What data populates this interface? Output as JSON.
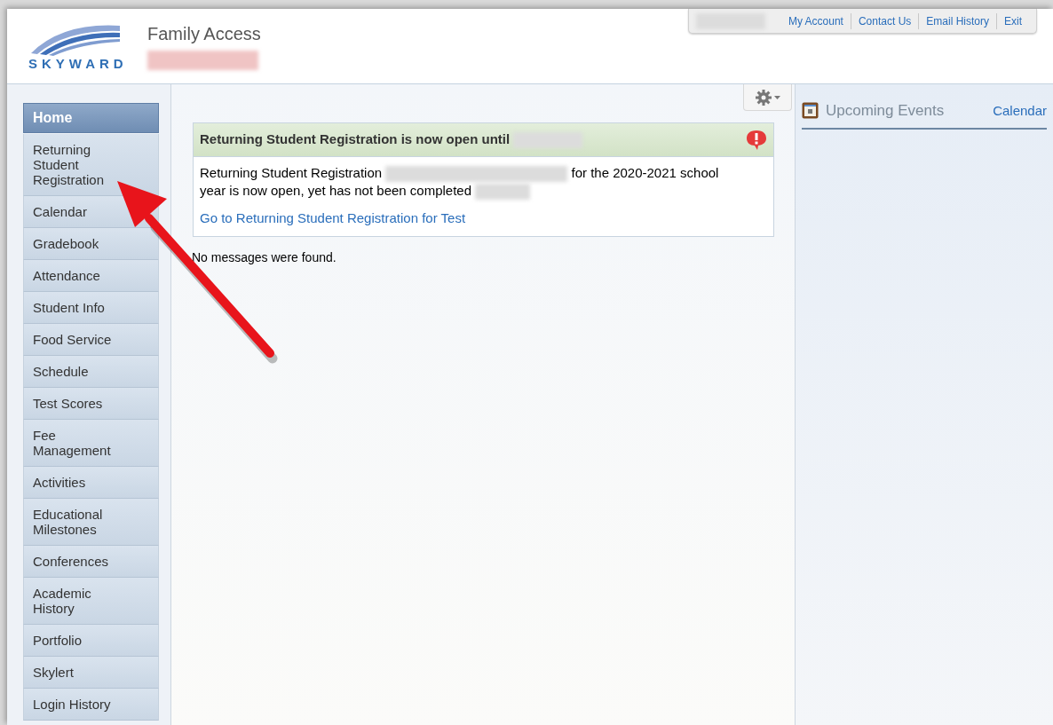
{
  "header": {
    "logo_text": "SKYWARD",
    "app_title": "Family Access",
    "name": {
      "kind": "redacted"
    },
    "links": [
      {
        "kind": "redacted"
      },
      {
        "kind": "link",
        "label": "My Account"
      },
      {
        "kind": "link",
        "label": "Contact Us"
      },
      {
        "kind": "link",
        "label": "Email History"
      },
      {
        "kind": "link",
        "label": "Exit"
      }
    ]
  },
  "sidebar": {
    "items": [
      {
        "label": "Home",
        "selected": true
      },
      {
        "label": "Returning Student Registration",
        "selected": false
      },
      {
        "label": "Calendar",
        "selected": false
      },
      {
        "label": "Gradebook",
        "selected": false
      },
      {
        "label": "Attendance",
        "selected": false
      },
      {
        "label": "Student Info",
        "selected": false
      },
      {
        "label": "Food Service",
        "selected": false
      },
      {
        "label": "Schedule",
        "selected": false
      },
      {
        "label": "Test Scores",
        "selected": false
      },
      {
        "label": "Fee Management",
        "selected": false
      },
      {
        "label": "Activities",
        "selected": false
      },
      {
        "label": "Educational Milestones",
        "selected": false
      },
      {
        "label": "Conferences",
        "selected": false
      },
      {
        "label": "Academic History",
        "selected": false
      },
      {
        "label": "Portfolio",
        "selected": false
      },
      {
        "label": "Skylert",
        "selected": false
      },
      {
        "label": "Login History",
        "selected": false
      }
    ]
  },
  "message": {
    "title": [
      {
        "kind": "text",
        "text": "Returning Student Registration is now open until"
      },
      {
        "kind": "redacted"
      }
    ],
    "body": [
      {
        "kind": "text",
        "text": "Returning Student Registration"
      },
      {
        "kind": "redacted"
      },
      {
        "kind": "text",
        "text": "for the 2020-2021 school year is now open, yet has not been completed"
      },
      {
        "kind": "redacted"
      }
    ],
    "link": "Go to Returning Student Registration for Test"
  },
  "no_messages": "No messages were found.",
  "events_panel": {
    "title": "Upcoming Events",
    "link": "Calendar"
  }
}
